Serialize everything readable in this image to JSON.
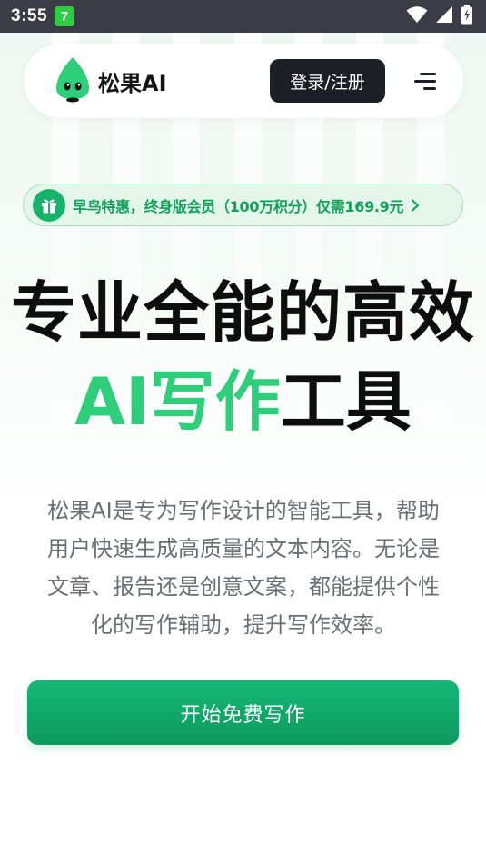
{
  "status_bar": {
    "time": "3:55",
    "notification_badge": "7",
    "icons": [
      "wifi-icon",
      "signal-icon",
      "battery-charging-icon"
    ]
  },
  "header": {
    "brand_name": "松果AI",
    "logo_icon": "pine-cone-mascot-icon",
    "login_label": "登录/注册",
    "menu_icon": "hamburger-menu-icon"
  },
  "promo": {
    "icon": "gift-icon",
    "text": "早鸟特惠，终身版会员（100万积分）仅需169.9元",
    "chevron_icon": "chevron-right-icon"
  },
  "hero": {
    "line1": "专业全能的高效",
    "line2_highlight": "AI写作",
    "line2_rest": "工具"
  },
  "description": {
    "lines": [
      "松果AI是专为写作设计的智能工具，帮助",
      "用户快速生成高质量的文本内容。无论是",
      "文章、报告还是创意文案，都能提供个性",
      "化的写作辅助，提升写作效率。"
    ]
  },
  "cta": {
    "label": "开始免费写作"
  },
  "colors": {
    "accent_green": "#2ecf7a",
    "button_green": "#12a86a",
    "dark": "#1c1f26",
    "status_bar": "#3a3d45"
  }
}
